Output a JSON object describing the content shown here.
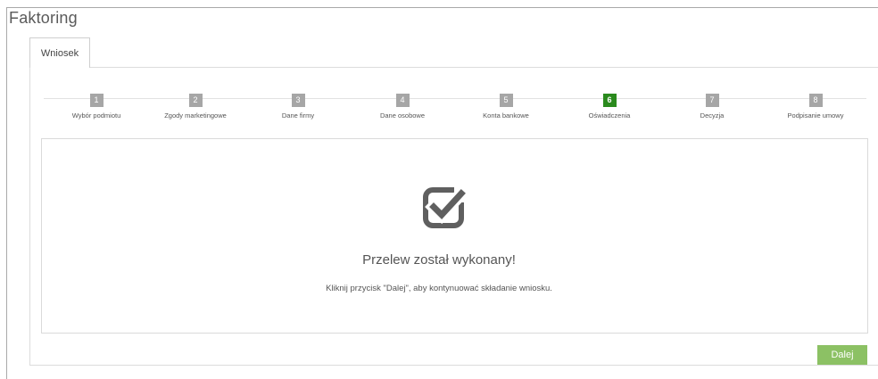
{
  "page": {
    "title": "Faktoring"
  },
  "tabs": [
    {
      "label": "Wniosek",
      "active": true
    }
  ],
  "steps": [
    {
      "number": "1",
      "label": "Wybór podmiotu",
      "active": false
    },
    {
      "number": "2",
      "label": "Zgody marketingowe",
      "active": false
    },
    {
      "number": "3",
      "label": "Dane firmy",
      "active": false
    },
    {
      "number": "4",
      "label": "Dane osobowe",
      "active": false
    },
    {
      "number": "5",
      "label": "Konta bankowe",
      "active": false
    },
    {
      "number": "6",
      "label": "Oświadczenia",
      "active": true
    },
    {
      "number": "7",
      "label": "Decyzja",
      "active": false
    },
    {
      "number": "8",
      "label": "Podpisanie umowy",
      "active": false
    }
  ],
  "content": {
    "icon": "checkbox-checked-icon",
    "title": "Przelew został wykonany!",
    "subtitle": "Kliknij przycisk \"Dalej\", aby kontynuować składanie wniosku."
  },
  "actions": {
    "next_label": "Dalej"
  },
  "colors": {
    "active_step": "#2a8a1d",
    "inactive_step": "#a6a6a6",
    "next_button": "#8cc164",
    "icon": "#5f5f5f"
  }
}
